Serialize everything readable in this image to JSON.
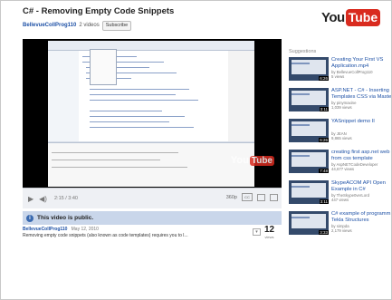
{
  "video": {
    "title": "C# - Removing Empty Code Snippets",
    "channel": "BellevueCollProg110",
    "video_count": "2 videos",
    "subscribe_label": "Subscribe",
    "is_public_text": "This video is public.",
    "upload_date": "May 12, 2010",
    "description": "Removing empty code snippets (also known as code templates) requires you to l...",
    "views_count": "12",
    "views_label": "views"
  },
  "logo": {
    "you": "You",
    "tube": "Tube"
  },
  "player": {
    "time_text": "2:15 / 3:40",
    "quality_label": "360p",
    "watermark_you": "You",
    "watermark_tube": "Tube"
  },
  "suggestions": {
    "header": "Suggestions",
    "items": [
      {
        "title": "Creating Your First VS",
        "title2": "Application.mp4",
        "channel": "by BellevueCollProg110",
        "views": "5 views",
        "duration": "6:26"
      },
      {
        "title": "ASP.NET - C# - Inserting",
        "title2": "Templates CSS via Master",
        "channel": "by pinymaxine",
        "views": "1,039 views",
        "duration": "3:11"
      },
      {
        "title": "YASnippet demo II",
        "title2": "",
        "channel": "by JEAN",
        "views": "9,865 views",
        "duration": "6:26"
      },
      {
        "title": "creating first asp.net web",
        "title2": "from css template",
        "channel": "by AspNETCodeDeveloper",
        "views": "44,677 views",
        "duration": "7:48"
      },
      {
        "title": "SkypeACOM API Open",
        "title2": "Example in C#",
        "channel": "by TheSkype0verLord",
        "views": "447 views",
        "duration": "3:11"
      },
      {
        "title": "C# example of programm",
        "title2": "Tekla Structures",
        "channel": "by simpda",
        "views": "2,179 views",
        "duration": "3:33"
      }
    ]
  },
  "colors": {
    "link": "#1e51a6",
    "accent": "#d92b1f",
    "public_bar": "#c9d6ea"
  }
}
